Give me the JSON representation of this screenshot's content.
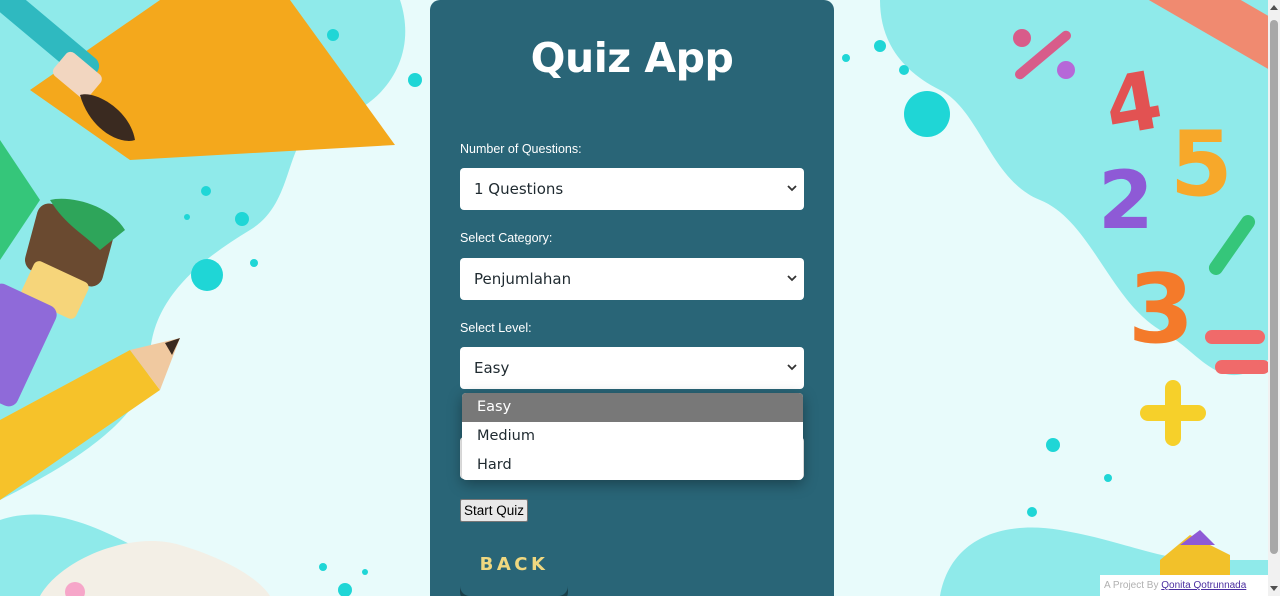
{
  "app": {
    "title": "Quiz App"
  },
  "form": {
    "questions": {
      "label": "Number of Questions:",
      "value": "1 Questions"
    },
    "category": {
      "label": "Select Category:",
      "value": "Penjumlahan"
    },
    "level": {
      "label": "Select Level:",
      "value": "Easy",
      "options": [
        "Easy",
        "Medium",
        "Hard"
      ],
      "highlighted": "Easy"
    }
  },
  "buttons": {
    "start": "Start Quiz",
    "back": "BACK"
  },
  "footer": {
    "prefix": "A Project By",
    "author": "Qonita Qotrunnada"
  },
  "colors": {
    "card": "#296577",
    "background": "#e8fbfb",
    "accent_text": "#f0d880",
    "highlight_option": "#787878"
  },
  "icons": {
    "select_arrow": "chevron-down-icon",
    "scroll_up": "triangle-up-icon",
    "scroll_down": "triangle-down-icon"
  }
}
